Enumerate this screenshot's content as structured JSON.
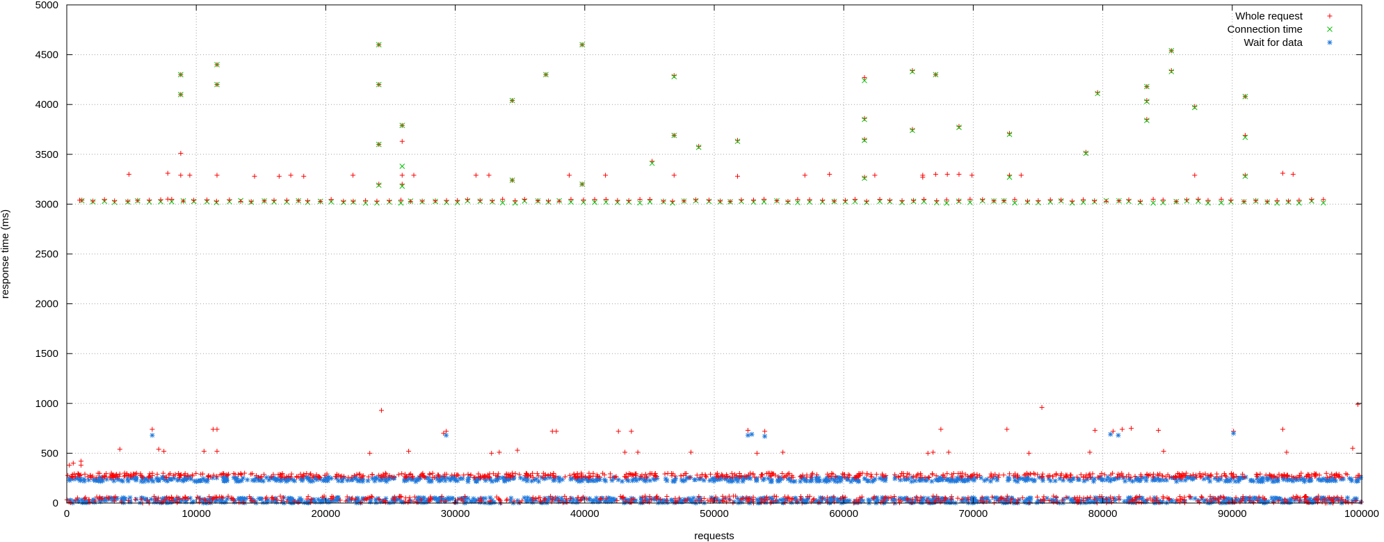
{
  "chart_data": {
    "type": "scatter",
    "xlabel": "requests",
    "ylabel": "response time (ms)",
    "xlim": [
      0,
      100000
    ],
    "ylim": [
      0,
      5000
    ],
    "xticks": [
      0,
      10000,
      20000,
      30000,
      40000,
      50000,
      60000,
      70000,
      80000,
      90000,
      100000
    ],
    "xtick_labels": [
      "0",
      "10000",
      "20000",
      "30000",
      "40000",
      "50000",
      "60000",
      "70000",
      "80000",
      "90000",
      "100000"
    ],
    "yticks": [
      0,
      500,
      1000,
      1500,
      2000,
      2500,
      3000,
      3500,
      4000,
      4500,
      5000
    ],
    "ytick_labels": [
      "0",
      "500",
      "1000",
      "1500",
      "2000",
      "2500",
      "3000",
      "3500",
      "4000",
      "4500",
      "5000"
    ],
    "grid": true,
    "legend_position": "top-right",
    "series": [
      {
        "name": "Whole request",
        "marker": "plus",
        "color": "#ff0000",
        "points": [
          [
            1000,
            3040
          ],
          [
            4800,
            3300
          ],
          [
            7800,
            3050
          ],
          [
            7800,
            3310
          ],
          [
            8800,
            4300
          ],
          [
            8800,
            4100
          ],
          [
            8800,
            3510
          ],
          [
            8800,
            3290
          ],
          [
            9500,
            3290
          ],
          [
            11600,
            4400
          ],
          [
            11600,
            4200
          ],
          [
            11600,
            3290
          ],
          [
            14500,
            3280
          ],
          [
            16400,
            3280
          ],
          [
            17300,
            3290
          ],
          [
            18300,
            3280
          ],
          [
            22100,
            3290
          ],
          [
            24100,
            4600
          ],
          [
            24100,
            4200
          ],
          [
            24100,
            3600
          ],
          [
            24100,
            3200
          ],
          [
            25900,
            3790
          ],
          [
            25900,
            3630
          ],
          [
            25900,
            3290
          ],
          [
            25900,
            3200
          ],
          [
            26800,
            3290
          ],
          [
            31600,
            3290
          ],
          [
            32600,
            3290
          ],
          [
            34400,
            4040
          ],
          [
            34400,
            3240
          ],
          [
            37000,
            4300
          ],
          [
            38800,
            3290
          ],
          [
            39800,
            4600
          ],
          [
            39800,
            3200
          ],
          [
            41600,
            3290
          ],
          [
            45200,
            3430
          ],
          [
            46900,
            4290
          ],
          [
            46900,
            3690
          ],
          [
            46900,
            3290
          ],
          [
            48800,
            3580
          ],
          [
            51800,
            3640
          ],
          [
            51800,
            3280
          ],
          [
            57000,
            3290
          ],
          [
            58900,
            3300
          ],
          [
            61600,
            4270
          ],
          [
            61600,
            3860
          ],
          [
            61600,
            3650
          ],
          [
            61600,
            3270
          ],
          [
            62400,
            3290
          ],
          [
            65300,
            4340
          ],
          [
            65300,
            3750
          ],
          [
            66100,
            3290
          ],
          [
            66100,
            3270
          ],
          [
            67100,
            4300
          ],
          [
            67100,
            3300
          ],
          [
            68000,
            3300
          ],
          [
            68900,
            3780
          ],
          [
            68900,
            3300
          ],
          [
            69900,
            3290
          ],
          [
            72800,
            3710
          ],
          [
            72800,
            3290
          ],
          [
            73700,
            3290
          ],
          [
            78700,
            3520
          ],
          [
            79600,
            4120
          ],
          [
            83400,
            4180
          ],
          [
            83400,
            4040
          ],
          [
            83400,
            3850
          ],
          [
            85300,
            4540
          ],
          [
            85300,
            4340
          ],
          [
            87100,
            3980
          ],
          [
            87100,
            3290
          ],
          [
            91000,
            4080
          ],
          [
            91000,
            3690
          ],
          [
            91000,
            3290
          ],
          [
            93900,
            3310
          ],
          [
            94700,
            3300
          ],
          [
            200,
            380
          ],
          [
            500,
            400
          ],
          [
            1100,
            420
          ],
          [
            1100,
            380
          ],
          [
            4100,
            540
          ],
          [
            6600,
            740
          ],
          [
            7100,
            540
          ],
          [
            7500,
            520
          ],
          [
            10600,
            520
          ],
          [
            11300,
            740
          ],
          [
            11600,
            740
          ],
          [
            11600,
            520
          ],
          [
            23400,
            500
          ],
          [
            24300,
            930
          ],
          [
            26400,
            520
          ],
          [
            29100,
            700
          ],
          [
            29300,
            720
          ],
          [
            32800,
            500
          ],
          [
            33400,
            510
          ],
          [
            34800,
            530
          ],
          [
            37500,
            720
          ],
          [
            37800,
            720
          ],
          [
            42600,
            720
          ],
          [
            43100,
            510
          ],
          [
            43600,
            720
          ],
          [
            44100,
            510
          ],
          [
            48200,
            510
          ],
          [
            52600,
            730
          ],
          [
            53300,
            500
          ],
          [
            53900,
            720
          ],
          [
            55300,
            510
          ],
          [
            66500,
            500
          ],
          [
            66900,
            510
          ],
          [
            67500,
            740
          ],
          [
            68100,
            510
          ],
          [
            72600,
            740
          ],
          [
            74300,
            500
          ],
          [
            75300,
            960
          ],
          [
            79000,
            510
          ],
          [
            79400,
            730
          ],
          [
            80800,
            720
          ],
          [
            81500,
            740
          ],
          [
            82200,
            750
          ],
          [
            84300,
            730
          ],
          [
            84700,
            520
          ],
          [
            90100,
            720
          ],
          [
            93900,
            740
          ],
          [
            94200,
            510
          ],
          [
            99300,
            550
          ],
          [
            99700,
            990
          ]
        ]
      },
      {
        "name": "Connection time",
        "marker": "cross",
        "color": "#00c000",
        "points": [
          [
            8800,
            4300
          ],
          [
            8800,
            4100
          ],
          [
            11600,
            4400
          ],
          [
            11600,
            4200
          ],
          [
            24100,
            4600
          ],
          [
            24100,
            4200
          ],
          [
            24100,
            3600
          ],
          [
            24100,
            3190
          ],
          [
            25900,
            3790
          ],
          [
            25900,
            3380
          ],
          [
            25900,
            3180
          ],
          [
            34400,
            4040
          ],
          [
            34400,
            3240
          ],
          [
            37000,
            4300
          ],
          [
            39800,
            4600
          ],
          [
            39800,
            3200
          ],
          [
            45200,
            3410
          ],
          [
            46900,
            4280
          ],
          [
            46900,
            3690
          ],
          [
            48800,
            3570
          ],
          [
            51800,
            3630
          ],
          [
            61600,
            4240
          ],
          [
            61600,
            3850
          ],
          [
            61600,
            3640
          ],
          [
            61600,
            3260
          ],
          [
            65300,
            4330
          ],
          [
            65300,
            3740
          ],
          [
            67100,
            4300
          ],
          [
            68900,
            3770
          ],
          [
            72800,
            3700
          ],
          [
            72800,
            3270
          ],
          [
            78700,
            3510
          ],
          [
            79600,
            4110
          ],
          [
            83400,
            4180
          ],
          [
            83400,
            4030
          ],
          [
            83400,
            3840
          ],
          [
            85300,
            4540
          ],
          [
            85300,
            4330
          ],
          [
            87100,
            3970
          ],
          [
            91000,
            4080
          ],
          [
            91000,
            3670
          ],
          [
            91000,
            3280
          ]
        ]
      },
      {
        "name": "Wait for data",
        "marker": "star",
        "color": "#1e78dc",
        "points": [
          [
            6600,
            680
          ],
          [
            29300,
            680
          ],
          [
            52600,
            680
          ],
          [
            52900,
            690
          ],
          [
            53900,
            670
          ],
          [
            80600,
            690
          ],
          [
            81200,
            680
          ],
          [
            90100,
            700
          ]
        ]
      }
    ]
  }
}
